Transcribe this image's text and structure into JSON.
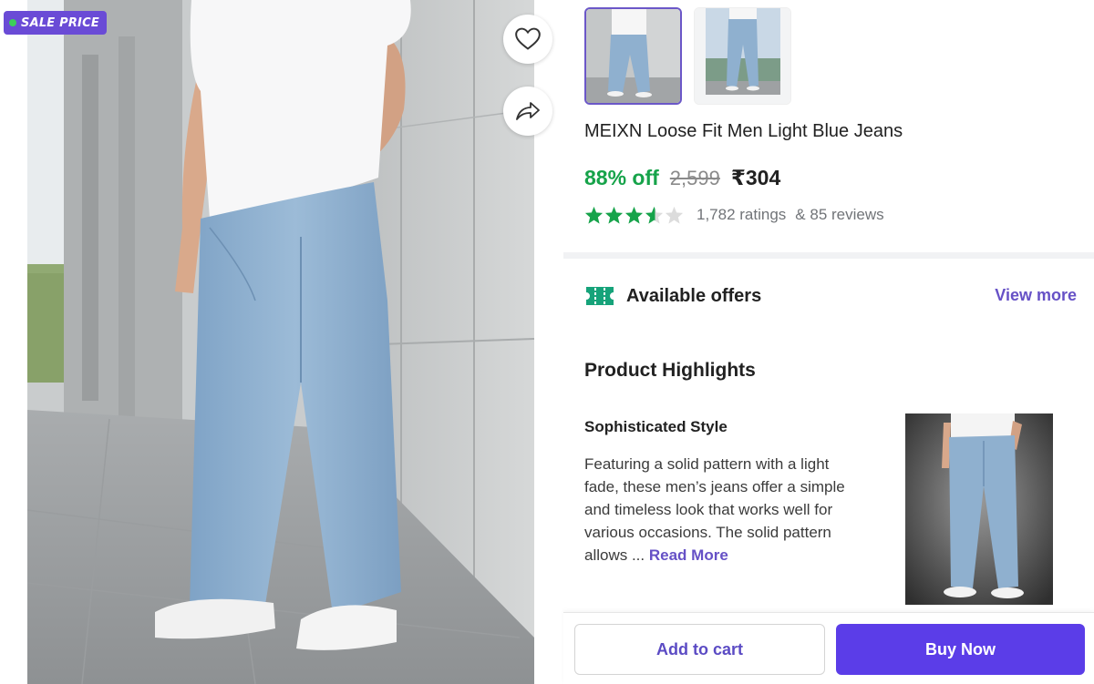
{
  "badge": {
    "label": "SALE PRICE"
  },
  "actions": {
    "wishlist_icon": "heart-icon",
    "share_icon": "share-icon"
  },
  "gallery": {
    "thumbnails": [
      {
        "alt": "jeans-front-view",
        "selected": true
      },
      {
        "alt": "jeans-full-view",
        "selected": false
      }
    ]
  },
  "product": {
    "title": "MEIXN Loose Fit Men Light Blue Jeans",
    "discount": "88% off",
    "mrp": "2,599",
    "price": "₹304",
    "rating": 3.5,
    "ratings_count": "1,782 ratings",
    "reviews_count": "& 85 reviews"
  },
  "offers": {
    "title": "Available offers",
    "view_more": "View more",
    "icon": "ticket-icon"
  },
  "highlights": {
    "title": "Product Highlights",
    "item_heading": "Sophisticated Style",
    "item_body": "Featuring a solid pattern with a light fade, these men’s jeans offer a simple and timeless look that works well for various occasions. The solid pattern allows ...",
    "read_more": "Read More"
  },
  "cta": {
    "add_to_cart": "Add to cart",
    "buy_now": "Buy Now"
  },
  "colors": {
    "accent": "#5b3de8",
    "link": "#6651c6",
    "discount_green": "#16a34a",
    "star_green": "#16a34a",
    "badge_purple": "#6a4bd6"
  }
}
